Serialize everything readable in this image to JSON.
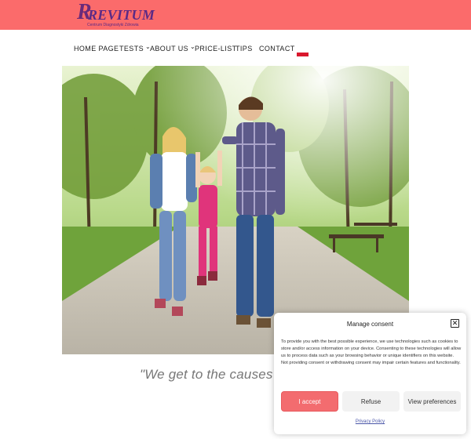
{
  "header": {
    "bg_color": "#fb6b6b",
    "logo_mark": "R",
    "logo_word": "REVITUM",
    "logo_tagline": "Centrum Diagnostyki Zdrowia",
    "logo_color": "#5b2a86"
  },
  "nav": {
    "items": [
      {
        "label": "HOME PAGE",
        "has_dropdown": false
      },
      {
        "label": "TESTS",
        "has_dropdown": true
      },
      {
        "label": "ABOUT US",
        "has_dropdown": true
      },
      {
        "label": "PRICE-LIST",
        "has_dropdown": false
      },
      {
        "label": "TIPS",
        "has_dropdown": false
      },
      {
        "label": "CONTACT",
        "has_dropdown": false
      }
    ],
    "chevron": "⌄",
    "language_flag": "poland-flag-icon"
  },
  "hero": {
    "image": "family-walking-in-park-photo"
  },
  "quote": {
    "text": "\"We get to the causes and fin"
  },
  "consent": {
    "title": "Manage consent",
    "close_icon": "close-icon",
    "body": "To provide you with the best possible experience, we use technologies such as cookies to store and/or access information on your device. Consenting to these technologies will allow us to process data such as your browsing behavior or unique identifiers on this website. Not providing consent or withdrawing consent may impair certain features and functionality.",
    "accept_label": "I accept",
    "refuse_label": "Refuse",
    "preferences_label": "View preferences",
    "privacy_link": "Privacy Policy",
    "accent_color": "#f36c6f"
  }
}
